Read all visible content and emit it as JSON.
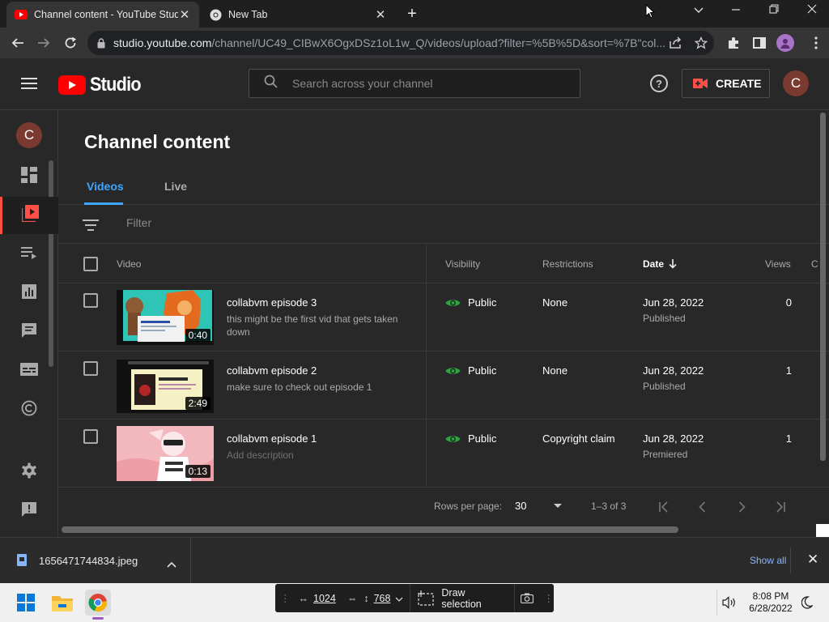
{
  "browser": {
    "tabs": [
      {
        "title": "Channel content - YouTube Studio",
        "active": true
      },
      {
        "title": "New Tab",
        "active": false
      }
    ],
    "address": {
      "host": "studio.youtube.com",
      "path": "/channel/UC49_CIBwX6OgxDSz1oL1w_Q/videos/upload?filter=%5B%5D&sort=%7B\"col..."
    }
  },
  "studio": {
    "logo_text": "Studio",
    "search_placeholder": "Search across your channel",
    "create_label": "CREATE",
    "avatar_letter": "C",
    "brand_color": "#ff0000",
    "accent_color": "#3ea6ff"
  },
  "nav": {
    "avatar_letter": "C",
    "items": [
      {
        "icon": "dashboard-icon"
      },
      {
        "icon": "content-icon",
        "active": true
      },
      {
        "icon": "playlists-icon"
      },
      {
        "icon": "analytics-icon"
      },
      {
        "icon": "comments-icon"
      },
      {
        "icon": "subtitles-icon"
      },
      {
        "icon": "copyright-icon"
      },
      {
        "icon": "settings-icon"
      },
      {
        "icon": "feedback-icon"
      }
    ]
  },
  "content": {
    "title": "Channel content",
    "tabs": [
      {
        "label": "Videos"
      },
      {
        "label": "Live"
      }
    ],
    "filter_placeholder": "Filter",
    "columns": {
      "video": "Video",
      "visibility": "Visibility",
      "restrictions": "Restrictions",
      "date": "Date",
      "views": "Views",
      "comments": "C"
    },
    "videos": [
      {
        "title": "collabvm episode 3",
        "description": "this might be the first vid that gets taken down",
        "duration": "0:40",
        "visibility": "Public",
        "restrictions": "None",
        "date": "Jun 28, 2022",
        "status": "Published",
        "views": "0"
      },
      {
        "title": "collabvm episode 2",
        "description": "make sure to check out episode 1",
        "duration": "2:49",
        "visibility": "Public",
        "restrictions": "None",
        "date": "Jun 28, 2022",
        "status": "Published",
        "views": "1"
      },
      {
        "title": "collabvm episode 1",
        "description": "Add description",
        "duration": "0:13",
        "visibility": "Public",
        "restrictions": "Copyright claim",
        "date": "Jun 28, 2022",
        "status": "Premiered",
        "views": "1"
      }
    ],
    "pagination": {
      "rows_label": "Rows per page:",
      "rows_value": "30",
      "range": "1–3 of 3"
    }
  },
  "downloads": {
    "file": "1656471744834.jpeg",
    "show_all": "Show all"
  },
  "taskbar": {
    "snip": {
      "width": "1024",
      "height": "768",
      "label": "Draw selection"
    },
    "time": "8:08 PM",
    "date": "6/28/2022"
  }
}
